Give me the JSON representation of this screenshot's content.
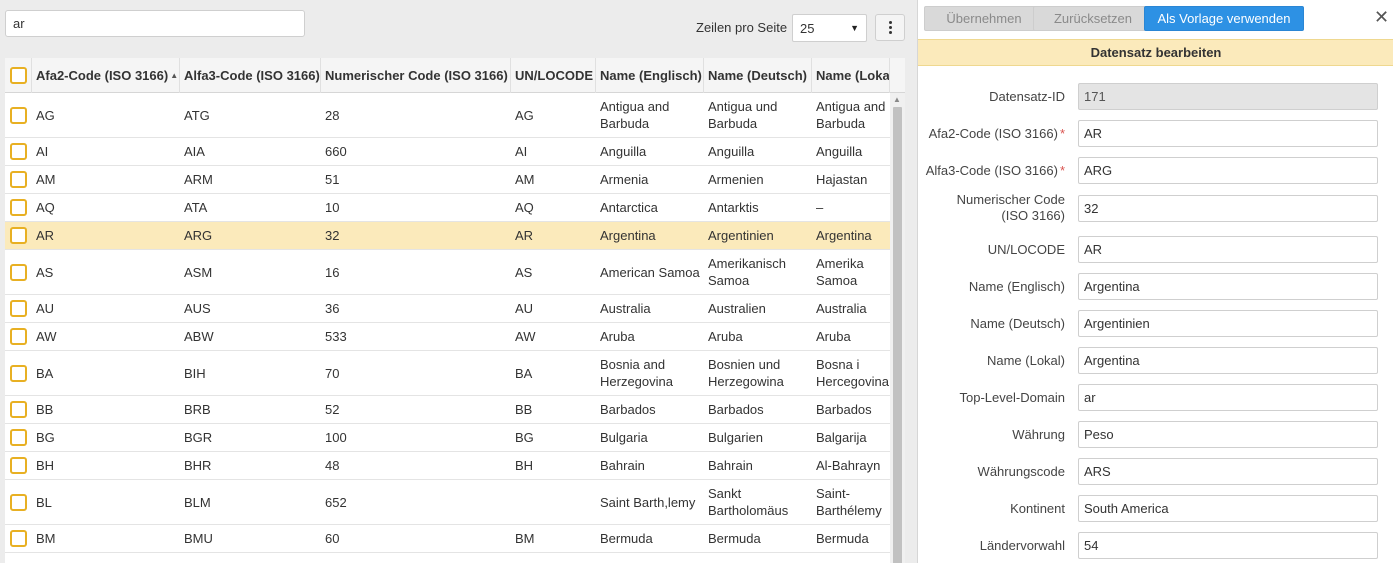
{
  "search": {
    "value": "ar"
  },
  "pagination": {
    "rows_per_page_label": "Zeilen pro Seite",
    "rows_per_page_value": "25"
  },
  "grid": {
    "columns": [
      {
        "key": "afa2",
        "label": "Afa2-Code (ISO 3166)",
        "sorted": "asc"
      },
      {
        "key": "alfa3",
        "label": "Alfa3-Code (ISO 3166)"
      },
      {
        "key": "num",
        "label": "Numerischer Code (ISO 3166)"
      },
      {
        "key": "unlocode",
        "label": "UN/LOCODE"
      },
      {
        "key": "name_en",
        "label": "Name (Englisch)"
      },
      {
        "key": "name_de",
        "label": "Name (Deutsch)"
      },
      {
        "key": "name_local",
        "label": "Name (Lokal)"
      }
    ],
    "rows": [
      {
        "afa2": "AG",
        "alfa3": "ATG",
        "num": "28",
        "unlocode": "AG",
        "name_en": "Antigua and Barbuda",
        "name_de": "Antigua und Barbuda",
        "name_local": "Antigua and Barbuda",
        "selected": false
      },
      {
        "afa2": "AI",
        "alfa3": "AIA",
        "num": "660",
        "unlocode": "AI",
        "name_en": "Anguilla",
        "name_de": "Anguilla",
        "name_local": "Anguilla",
        "selected": false
      },
      {
        "afa2": "AM",
        "alfa3": "ARM",
        "num": "51",
        "unlocode": "AM",
        "name_en": "Armenia",
        "name_de": "Armenien",
        "name_local": "Hajastan",
        "selected": false
      },
      {
        "afa2": "AQ",
        "alfa3": "ATA",
        "num": "10",
        "unlocode": "AQ",
        "name_en": "Antarctica",
        "name_de": "Antarktis",
        "name_local": "–",
        "selected": false
      },
      {
        "afa2": "AR",
        "alfa3": "ARG",
        "num": "32",
        "unlocode": "AR",
        "name_en": "Argentina",
        "name_de": "Argentinien",
        "name_local": "Argentina",
        "selected": true
      },
      {
        "afa2": "AS",
        "alfa3": "ASM",
        "num": "16",
        "unlocode": "AS",
        "name_en": "American Samoa",
        "name_de": "Amerikanisch Samoa",
        "name_local": "Amerika Samoa",
        "selected": false
      },
      {
        "afa2": "AU",
        "alfa3": "AUS",
        "num": "36",
        "unlocode": "AU",
        "name_en": "Australia",
        "name_de": "Australien",
        "name_local": "Australia",
        "selected": false
      },
      {
        "afa2": "AW",
        "alfa3": "ABW",
        "num": "533",
        "unlocode": "AW",
        "name_en": "Aruba",
        "name_de": "Aruba",
        "name_local": "Aruba",
        "selected": false
      },
      {
        "afa2": "BA",
        "alfa3": "BIH",
        "num": "70",
        "unlocode": "BA",
        "name_en": "Bosnia and Herzegovina",
        "name_de": "Bosnien und Herzegowina",
        "name_local": "Bosna i Hercegovina",
        "selected": false
      },
      {
        "afa2": "BB",
        "alfa3": "BRB",
        "num": "52",
        "unlocode": "BB",
        "name_en": "Barbados",
        "name_de": "Barbados",
        "name_local": "Barbados",
        "selected": false
      },
      {
        "afa2": "BG",
        "alfa3": "BGR",
        "num": "100",
        "unlocode": "BG",
        "name_en": "Bulgaria",
        "name_de": "Bulgarien",
        "name_local": "Balgarija",
        "selected": false
      },
      {
        "afa2": "BH",
        "alfa3": "BHR",
        "num": "48",
        "unlocode": "BH",
        "name_en": "Bahrain",
        "name_de": "Bahrain",
        "name_local": "Al-Bahrayn",
        "selected": false
      },
      {
        "afa2": "BL",
        "alfa3": "BLM",
        "num": "652",
        "unlocode": "",
        "name_en": "Saint Barth,lemy",
        "name_de": "Sankt Bartholomäus",
        "name_local": "Saint-Barthélemy",
        "selected": false
      },
      {
        "afa2": "BM",
        "alfa3": "BMU",
        "num": "60",
        "unlocode": "BM",
        "name_en": "Bermuda",
        "name_de": "Bermuda",
        "name_local": "Bermuda",
        "selected": false
      }
    ]
  },
  "toolbar": {
    "apply_label": "Übernehmen",
    "reset_label": "Zurücksetzen",
    "template_label": "Als Vorlage verwenden",
    "close_icon": "close-icon"
  },
  "form": {
    "title": "Datensatz bearbeiten",
    "fields": [
      {
        "label": "Datensatz-ID",
        "value": "171",
        "required": false,
        "readonly": true
      },
      {
        "label": "Afa2-Code (ISO 3166)",
        "value": "AR",
        "required": true
      },
      {
        "label": "Alfa3-Code (ISO 3166)",
        "value": "ARG",
        "required": true
      },
      {
        "label": "Numerischer Code (ISO 3166)",
        "value": "32",
        "required": false
      },
      {
        "label": "UN/LOCODE",
        "value": "AR",
        "required": false
      },
      {
        "label": "Name (Englisch)",
        "value": "Argentina",
        "required": false
      },
      {
        "label": "Name (Deutsch)",
        "value": "Argentinien",
        "required": false
      },
      {
        "label": "Name (Lokal)",
        "value": "Argentina",
        "required": false
      },
      {
        "label": "Top-Level-Domain",
        "value": "ar",
        "required": false
      },
      {
        "label": "Währung",
        "value": "Peso",
        "required": false
      },
      {
        "label": "Währungscode",
        "value": "ARS",
        "required": false
      },
      {
        "label": "Kontinent",
        "value": "South America",
        "required": false
      },
      {
        "label": "Ländervorwahl",
        "value": "54",
        "required": false
      }
    ]
  },
  "colors": {
    "accent": "#2d91e4",
    "selected_row": "#fbeabb",
    "checkbox": "#e8b023",
    "required": "#d9534f"
  }
}
